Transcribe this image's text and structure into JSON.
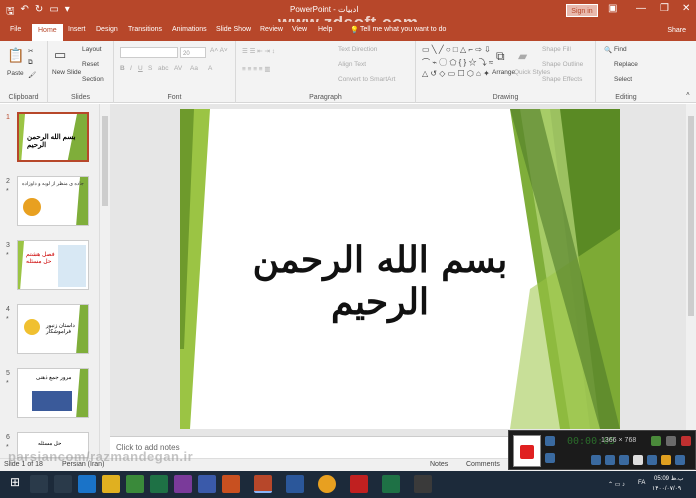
{
  "titlebar": {
    "title": "PowerPoint - ادبیات",
    "signin": "Sign in",
    "watermark": "www.zdsoft.com"
  },
  "tabs": [
    "File",
    "Home",
    "Insert",
    "Design",
    "Transitions",
    "Animations",
    "Slide Show",
    "Review",
    "View",
    "Help"
  ],
  "tell_me": "Tell me what you want to do",
  "share": "Share",
  "ribbon": {
    "clipboard": {
      "label": "Clipboard",
      "paste": "Paste"
    },
    "slides": {
      "label": "Slides",
      "new_slide": "New Slide",
      "layout": "Layout",
      "reset": "Reset",
      "section": "Section"
    },
    "font": {
      "label": "Font",
      "size": "20"
    },
    "paragraph": {
      "label": "Paragraph",
      "text_direction": "Text Direction",
      "align_text": "Align Text",
      "convert": "Convert to SmartArt"
    },
    "drawing": {
      "label": "Drawing",
      "arrange": "Arrange",
      "quick_styles": "Quick Styles",
      "shape_fill": "Shape Fill",
      "shape_outline": "Shape Outline",
      "shape_effects": "Shape Effects"
    },
    "editing": {
      "label": "Editing",
      "find": "Find",
      "replace": "Replace",
      "select": "Select"
    }
  },
  "thumbnails": [
    {
      "num": "1",
      "text": "بسم الله الرحمن الرحیم"
    },
    {
      "num": "2",
      "text": "جاده ی منظر از لوبه و داوزاده"
    },
    {
      "num": "3",
      "text": "فصل هشتم حل مسئله"
    },
    {
      "num": "4",
      "text": "داستان زنبور فراموشکار"
    },
    {
      "num": "5",
      "text": "مرور جمع ذهنی"
    },
    {
      "num": "6",
      "text": "حل مسئله"
    }
  ],
  "slide": {
    "calligraphy": "بسم الله الرحمن الرحیم"
  },
  "notes_placeholder": "Click to add notes",
  "status": {
    "slide_of": "Slide 1 of 18",
    "language": "Persian (Iran)",
    "notes": "Notes",
    "comments": "Comments"
  },
  "recorder": {
    "digits": "00:00:05",
    "resolution": "1366 × 768"
  },
  "bottom_watermark": "parsiancom/razmandegan.ir",
  "clock": {
    "time": "05:09 ب.ظ",
    "date": "۱۴۰۰/۰۷/۰۹",
    "lang": "FA"
  },
  "colors": {
    "brand": "#b7472a",
    "green_dark": "#4f7a28",
    "green_light": "#9bc444"
  }
}
